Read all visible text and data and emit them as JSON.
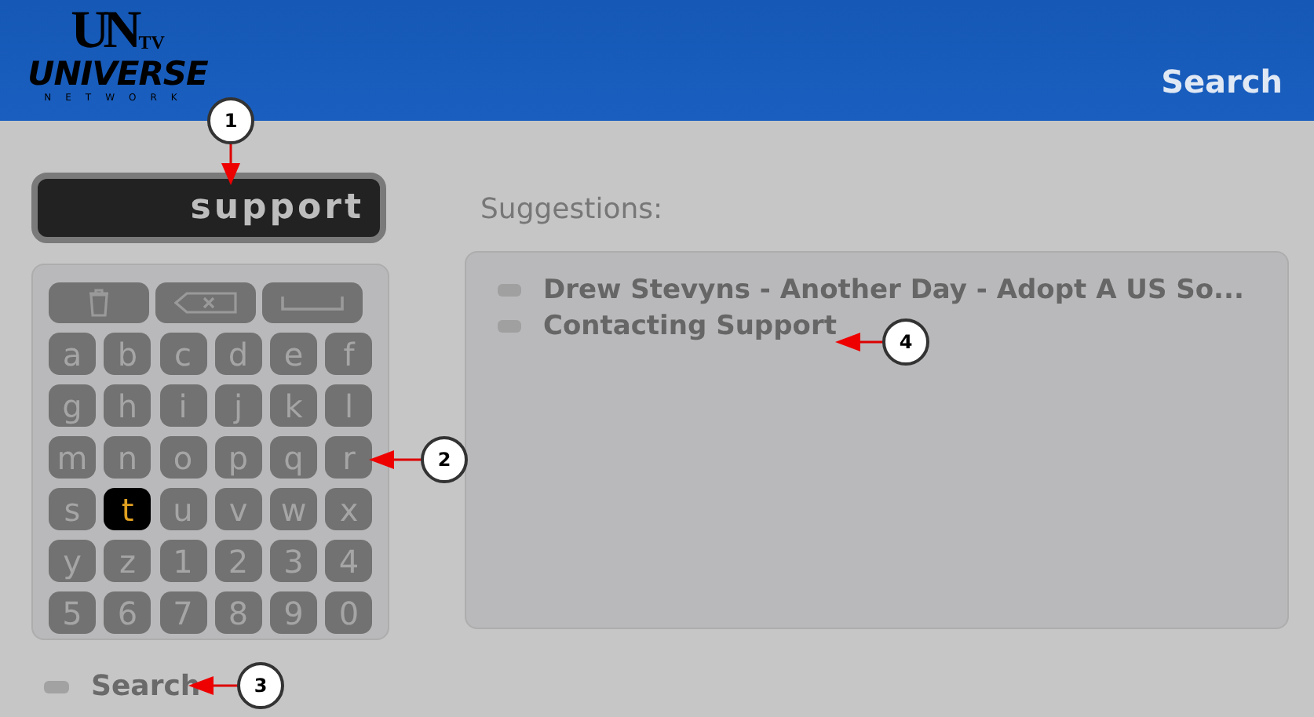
{
  "header": {
    "logo": {
      "mark": "UN",
      "tv": "TV",
      "name": "UNIVERSE",
      "sub": "NETWORK"
    },
    "title": "Search"
  },
  "search_field": {
    "value": "support"
  },
  "keyboard": {
    "keys": [
      {
        "kind": "trash"
      },
      {
        "kind": "backspace"
      },
      {
        "kind": "space"
      },
      {
        "kind": "char",
        "label": "a",
        "selected": false
      },
      {
        "kind": "char",
        "label": "b",
        "selected": false
      },
      {
        "kind": "char",
        "label": "c",
        "selected": false
      },
      {
        "kind": "char",
        "label": "d",
        "selected": false
      },
      {
        "kind": "char",
        "label": "e",
        "selected": false
      },
      {
        "kind": "char",
        "label": "f",
        "selected": false
      },
      {
        "kind": "char",
        "label": "g",
        "selected": false
      },
      {
        "kind": "char",
        "label": "h",
        "selected": false
      },
      {
        "kind": "char",
        "label": "i",
        "selected": false
      },
      {
        "kind": "char",
        "label": "j",
        "selected": false
      },
      {
        "kind": "char",
        "label": "k",
        "selected": false
      },
      {
        "kind": "char",
        "label": "l",
        "selected": false
      },
      {
        "kind": "char",
        "label": "m",
        "selected": false
      },
      {
        "kind": "char",
        "label": "n",
        "selected": false
      },
      {
        "kind": "char",
        "label": "o",
        "selected": false
      },
      {
        "kind": "char",
        "label": "p",
        "selected": false
      },
      {
        "kind": "char",
        "label": "q",
        "selected": false
      },
      {
        "kind": "char",
        "label": "r",
        "selected": false
      },
      {
        "kind": "char",
        "label": "s",
        "selected": false
      },
      {
        "kind": "char",
        "label": "t",
        "selected": true
      },
      {
        "kind": "char",
        "label": "u",
        "selected": false
      },
      {
        "kind": "char",
        "label": "v",
        "selected": false
      },
      {
        "kind": "char",
        "label": "w",
        "selected": false
      },
      {
        "kind": "char",
        "label": "x",
        "selected": false
      },
      {
        "kind": "char",
        "label": "y",
        "selected": false
      },
      {
        "kind": "char",
        "label": "z",
        "selected": false
      },
      {
        "kind": "char",
        "label": "1",
        "selected": false
      },
      {
        "kind": "char",
        "label": "2",
        "selected": false
      },
      {
        "kind": "char",
        "label": "3",
        "selected": false
      },
      {
        "kind": "char",
        "label": "4",
        "selected": false
      },
      {
        "kind": "char",
        "label": "5",
        "selected": false
      },
      {
        "kind": "char",
        "label": "6",
        "selected": false
      },
      {
        "kind": "char",
        "label": "7",
        "selected": false
      },
      {
        "kind": "char",
        "label": "8",
        "selected": false
      },
      {
        "kind": "char",
        "label": "9",
        "selected": false
      },
      {
        "kind": "char",
        "label": "0",
        "selected": false
      }
    ]
  },
  "search_button": {
    "label": "Search"
  },
  "suggestions": {
    "label": "Suggestions:",
    "items": [
      {
        "text": "Drew Stevyns - Another Day - Adopt A US So..."
      },
      {
        "text": "Contacting Support"
      }
    ]
  },
  "callouts": [
    "1",
    "2",
    "3",
    "4"
  ]
}
